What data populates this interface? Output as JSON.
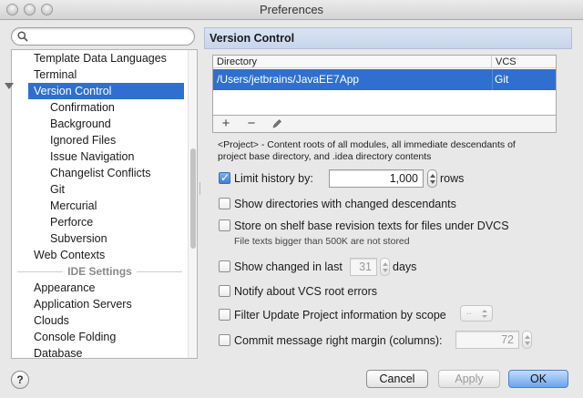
{
  "window": {
    "title": "Preferences"
  },
  "search": {
    "placeholder": "",
    "value": ""
  },
  "tree": {
    "items_before": [
      "Template Data Languages",
      "Terminal"
    ],
    "selected": "Version Control",
    "children": [
      "Confirmation",
      "Background",
      "Ignored Files",
      "Issue Navigation",
      "Changelist Conflicts",
      "Git",
      "Mercurial",
      "Perforce",
      "Subversion"
    ],
    "items_after": [
      "Web Contexts"
    ],
    "group_label": "IDE Settings",
    "ide_items": [
      "Appearance",
      "Application Servers",
      "Clouds",
      "Console Folding",
      "Database"
    ]
  },
  "panel": {
    "title": "Version Control",
    "table": {
      "columns": [
        "Directory",
        "VCS"
      ],
      "rows": [
        [
          "/Users/jetbrains/JavaEE7App",
          "Git"
        ]
      ]
    },
    "toolbar": {
      "add": "+",
      "remove": "−"
    },
    "note": "<Project> - Content roots of all modules, all immediate descendants of project base directory, and .idea directory contents",
    "options": {
      "limit_history": {
        "label": "Limit history by:",
        "checked": true,
        "value": "1,000",
        "unit": "rows"
      },
      "show_dirs": {
        "label": "Show directories with changed descendants",
        "checked": false
      },
      "store_shelf": {
        "label": "Store on shelf base revision texts for files under DVCS",
        "checked": false,
        "hint": "File texts bigger than 500K are not stored"
      },
      "show_changed": {
        "label": "Show changed in last",
        "checked": false,
        "value": "31",
        "unit": "days"
      },
      "notify_root": {
        "label": "Notify about VCS root errors",
        "checked": false
      },
      "filter_update": {
        "label": "Filter Update Project information by scope",
        "checked": false,
        "combo": ".."
      },
      "commit_margin": {
        "label": "Commit message right margin (columns):",
        "checked": false,
        "value": "72"
      }
    }
  },
  "buttons": {
    "help": "?",
    "cancel": "Cancel",
    "apply": "Apply",
    "ok": "OK"
  }
}
